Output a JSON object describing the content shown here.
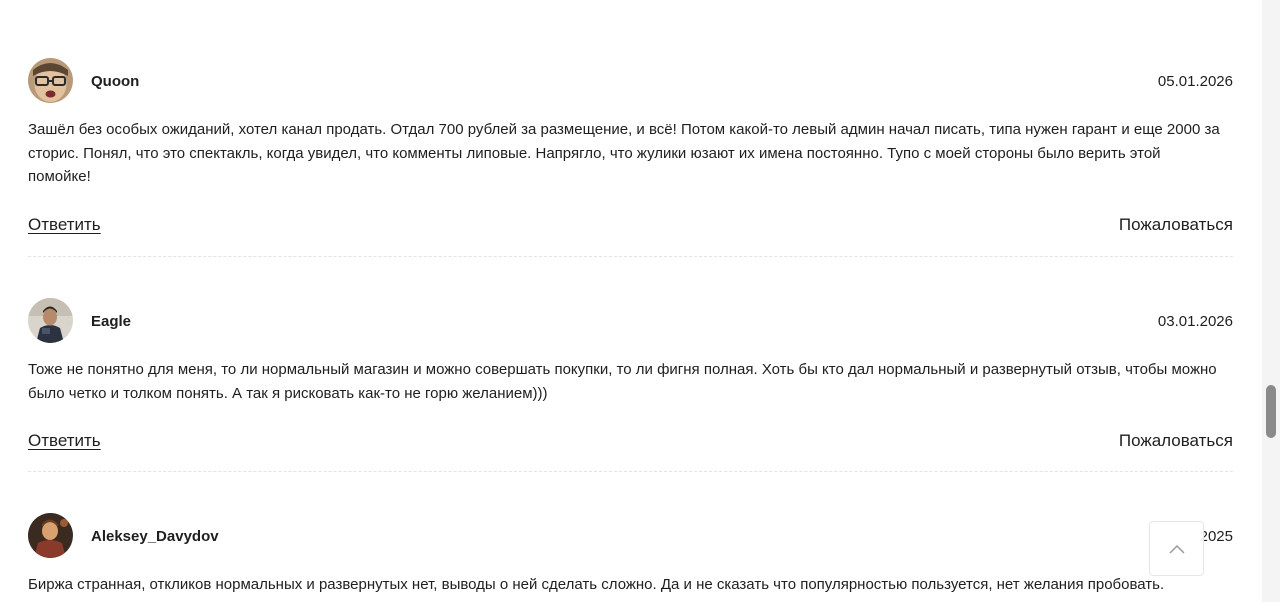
{
  "comments": [
    {
      "author": "Quoon",
      "date": "05.01.2026",
      "avatar": "avatar-quoon",
      "text": "Зашёл без особых ожиданий, хотел канал продать. Отдал 700 рублей за размещение, и всё! Потом какой-то левый админ начал писать, типа нужен гарант и еще 2000 за сторис. Понял, что это спектакль, когда увидел, что комменты липовые. Напрягло, что жулики юзают их имена постоянно. Тупо с моей стороны было верить этой помойке!",
      "reply_label": "Ответить",
      "report_label": "Пожаловаться"
    },
    {
      "author": "Eagle",
      "date": "03.01.2026",
      "avatar": "avatar-eagle",
      "text": "Тоже не понятно для меня, то ли нормальный магазин и можно совершать покупки, то ли фигня полная. Хоть бы кто дал нормальный и развернутый отзыв, чтобы можно было четко и толком понять. А так я рисковать как-то не горю желанием)))",
      "reply_label": "Ответить",
      "report_label": "Пожаловаться"
    },
    {
      "author": "Aleksey_Davydov",
      "date": "2025",
      "avatar": "avatar-aleksey",
      "text": "Биржа странная, откликов нормальных и развернутых нет, выводы о ней сделать сложно. Да и не сказать что популярностью пользуется, нет желания пробовать."
    }
  ],
  "scroll_to_top": {
    "icon": "chevron-up-icon"
  },
  "colors": {
    "text": "#1f1f1f",
    "divider": "#e3e3e3",
    "scrollbar_thumb": "#8a8a8a"
  }
}
